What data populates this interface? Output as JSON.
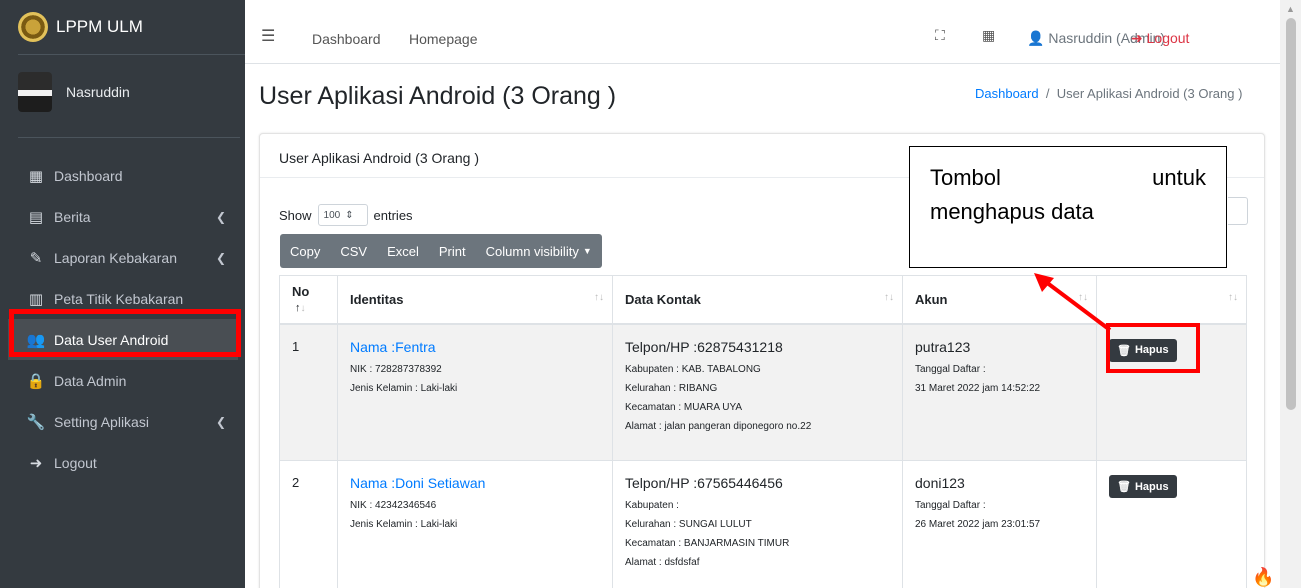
{
  "sidebar": {
    "brand": "LPPM ULM",
    "user_name": "Nasruddin",
    "items": [
      {
        "label": "Dashboard",
        "icon": "grid-icon",
        "caret": false
      },
      {
        "label": "Berita",
        "icon": "newspaper-icon",
        "caret": true
      },
      {
        "label": "Laporan Kebakaran",
        "icon": "edit-icon",
        "caret": true
      },
      {
        "label": "Peta Titik Kebakaran",
        "icon": "map-icon",
        "caret": false
      },
      {
        "label": "Data User Android",
        "icon": "users-icon",
        "caret": false
      },
      {
        "label": "Data Admin",
        "icon": "lock-icon",
        "caret": false
      },
      {
        "label": "Setting Aplikasi",
        "icon": "wrench-icon",
        "caret": true
      },
      {
        "label": "Logout",
        "icon": "sign-out-icon",
        "caret": false
      }
    ]
  },
  "topbar": {
    "links": [
      "Dashboard",
      "Homepage"
    ],
    "admin": "Nasruddin (Admin)",
    "logout": "Logout"
  },
  "content": {
    "title": "User Aplikasi Android (3 Orang )",
    "breadcrumb_home": "Dashboard",
    "breadcrumb_current": "User Aplikasi Android (3 Orang )",
    "card_title": "User Aplikasi Android (3 Orang )",
    "show_label": "Show",
    "entries_value": "100",
    "entries_label": "entries",
    "buttons": [
      "Copy",
      "CSV",
      "Excel",
      "Print",
      "Column visibility"
    ]
  },
  "table": {
    "headers": [
      "No",
      "Identitas",
      "Data Kontak",
      "Akun",
      ""
    ],
    "rows": [
      {
        "no": "1",
        "nama": "Nama :Fentra",
        "nik": "NIK : 728287378392",
        "jk": "Jenis Kelamin : Laki-laki",
        "telpon": "Telpon/HP :62875431218",
        "kabupaten": "Kabupaten : KAB. TABALONG",
        "kelurahan": "Kelurahan : RIBANG",
        "kecamatan": "Kecamatan : MUARA UYA",
        "alamat": "Alamat : jalan pangeran diponegoro no.22",
        "akun": "putra123",
        "tgl_label": "Tanggal Daftar :",
        "tgl": "31 Maret 2022 jam 14:52:22",
        "action": "Hapus"
      },
      {
        "no": "2",
        "nama": "Nama :Doni Setiawan",
        "nik": "NIK : 42342346546",
        "jk": "Jenis Kelamin : Laki-laki",
        "telpon": "Telpon/HP :67565446456",
        "kabupaten": "Kabupaten :",
        "kelurahan": "Kelurahan : SUNGAI LULUT",
        "kecamatan": "Kecamatan : BANJARMASIN TIMUR",
        "alamat": "Alamat : dsfdsfaf",
        "akun": "doni123",
        "tgl_label": "Tanggal Daftar :",
        "tgl": "26 Maret 2022 jam 23:01:57",
        "action": "Hapus"
      }
    ]
  },
  "annotation": {
    "line1_a": "Tombol",
    "line1_b": "untuk",
    "line2": "menghapus data",
    "highlight_color": "#ff0000"
  }
}
